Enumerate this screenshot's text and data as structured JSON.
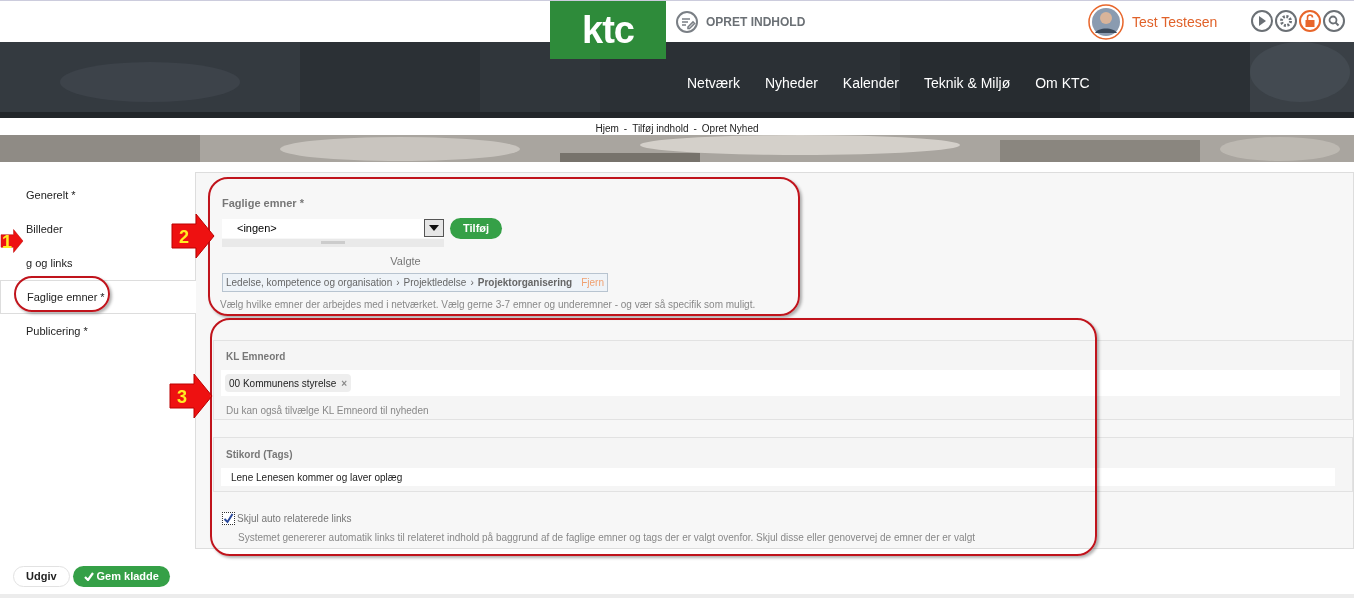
{
  "header": {
    "logo": "ktc",
    "create_link": "OPRET INDHOLD",
    "user": "Test Testesen"
  },
  "nav": {
    "items": [
      "Netværk",
      "Nyheder",
      "Kalender",
      "Teknik & Miljø",
      "Om KTC"
    ]
  },
  "breadcrumb": {
    "separator": "-",
    "items": [
      "Hjem",
      "Tilføj indhold",
      "Opret Nyhed"
    ]
  },
  "sidebar": {
    "items": [
      {
        "label": "Generelt *",
        "selected": false
      },
      {
        "label": "Billeder",
        "selected": false
      },
      {
        "label": "g og links",
        "selected": false
      },
      {
        "label": "Faglige emner *",
        "selected": true
      },
      {
        "label": "Publicering *",
        "selected": false
      }
    ]
  },
  "annotations": [
    {
      "number": "1"
    },
    {
      "number": "2"
    },
    {
      "number": "3"
    }
  ],
  "topics": {
    "label": "Faglige emner *",
    "select_value": "<ingen>",
    "add_button": "Tilføj",
    "chosen_label": "Valgte",
    "chosen": {
      "path": [
        "Ledelse, kompetence og organisation",
        "Projektledelse",
        "Projektorganisering"
      ],
      "separator": "›",
      "remove": "Fjern"
    },
    "help": "Vælg hvilke emner der arbejdes med i netværket. Vælg gerne 3-7 emner og underemner - og vær så specifik som muligt."
  },
  "kl_keywords": {
    "label": "KL Emneord",
    "tags": [
      {
        "label": "00 Kommunens styrelse",
        "remove": "×"
      }
    ],
    "help": "Du kan også tilvælge KL Emneord til nyheden"
  },
  "tags_field": {
    "label": "Stikord (Tags)",
    "value": "Lene Lenesen kommer og laver oplæg"
  },
  "hide_links": {
    "label": "Skjul auto relaterede links",
    "checked": true,
    "description": "Systemet genererer automatik links til relateret indhold på baggrund af de faglige emner og tags der er valgt ovenfor. Skjul disse eller genovervej de emner der er valgt"
  },
  "buttons": [
    {
      "label": "Udgiv",
      "kind": "plain"
    },
    {
      "label": "Gem kladde",
      "kind": "primary"
    }
  ]
}
